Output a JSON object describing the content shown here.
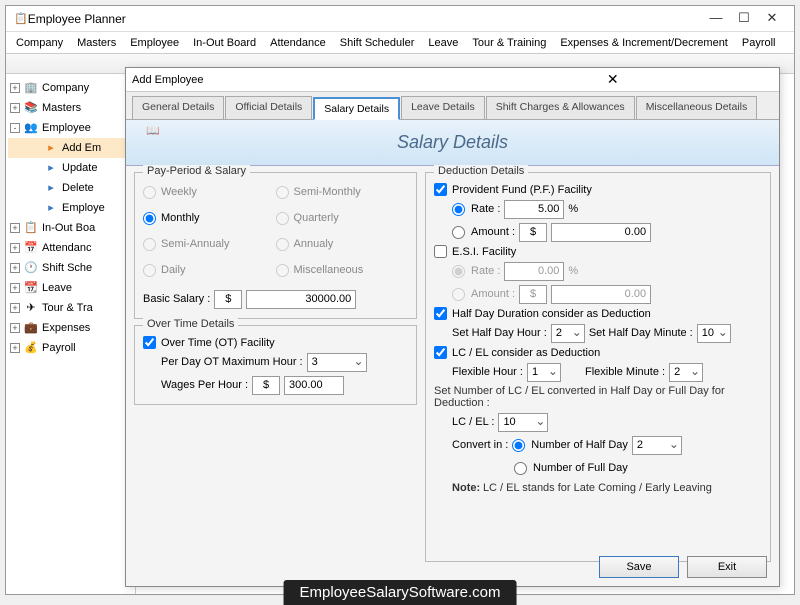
{
  "window": {
    "title": "Employee Planner"
  },
  "menu": [
    "Company",
    "Masters",
    "Employee",
    "In-Out Board",
    "Attendance",
    "Shift Scheduler",
    "Leave",
    "Tour & Training",
    "Expenses & Increment/Decrement",
    "Payroll"
  ],
  "tree": {
    "items": [
      {
        "label": "Company",
        "icon": "🏢"
      },
      {
        "label": "Masters",
        "icon": "📚"
      },
      {
        "label": "Employee",
        "icon": "👥",
        "expanded": true,
        "children": [
          {
            "label": "Add Em",
            "icon": "➕",
            "active": true
          },
          {
            "label": "Update",
            "icon": "▶"
          },
          {
            "label": "Delete",
            "icon": "▶"
          },
          {
            "label": "Employe",
            "icon": "▶"
          }
        ]
      },
      {
        "label": "In-Out Boa",
        "icon": "📋"
      },
      {
        "label": "Attendanc",
        "icon": "📅"
      },
      {
        "label": "Shift Sche",
        "icon": "🕐"
      },
      {
        "label": "Leave",
        "icon": "📆"
      },
      {
        "label": "Tour & Tra",
        "icon": "✈"
      },
      {
        "label": "Expenses",
        "icon": "💼"
      },
      {
        "label": "Payroll",
        "icon": "💰"
      }
    ]
  },
  "dialog": {
    "title": "Add Employee",
    "tabs": [
      "General Details",
      "Official Details",
      "Salary Details",
      "Leave Details",
      "Shift Charges & Allowances",
      "Miscellaneous Details"
    ],
    "active_tab": "Salary Details",
    "banner": "Salary Details",
    "pay_period": {
      "title": "Pay-Period & Salary",
      "options": [
        "Weekly",
        "Semi-Monthly",
        "Monthly",
        "Quarterly",
        "Semi-Annualy",
        "Annualy",
        "Daily",
        "Miscellaneous"
      ],
      "selected": "Monthly",
      "basic_label": "Basic Salary :",
      "currency": "$",
      "basic_value": "30000.00"
    },
    "overtime": {
      "title": "Over Time Details",
      "check": "Over Time (OT) Facility",
      "checked": true,
      "per_day_label": "Per Day OT Maximum Hour :",
      "per_day_value": "3",
      "wages_label": "Wages Per Hour :",
      "wages_value": "300.00"
    },
    "deduction": {
      "title": "Deduction Details",
      "pf": {
        "label": "Provident Fund (P.F.) Facility",
        "checked": true,
        "rate": "5.00",
        "amount": "0.00",
        "mode": "rate"
      },
      "esi": {
        "label": "E.S.I. Facility",
        "checked": false,
        "rate": "0.00",
        "amount": "0.00",
        "mode": "rate"
      },
      "halfday": {
        "label": "Half Day Duration consider as Deduction",
        "checked": true,
        "hour_label": "Set Half Day Hour :",
        "hour": "2",
        "min_label": "Set Half Day Minute :",
        "min": "10"
      },
      "lcel": {
        "label": "LC / EL consider as Deduction",
        "checked": true,
        "flex_hour_label": "Flexible Hour :",
        "flex_hour": "1",
        "flex_min_label": "Flexible Minute :",
        "flex_min": "2",
        "set_label": "Set Number of LC / EL converted in Half Day or Full Day for Deduction :",
        "lcel_label": "LC / EL :",
        "lcel_val": "10",
        "convert_label": "Convert in :",
        "opt1": "Number of Half Day",
        "opt2": "Number of Full Day",
        "convert_val": "2"
      },
      "note_label": "Note:",
      "note": "LC / EL stands for Late Coming / Early Leaving"
    },
    "save": "Save",
    "exit": "Exit"
  },
  "watermark": "EmployeeSalarySoftware.com"
}
